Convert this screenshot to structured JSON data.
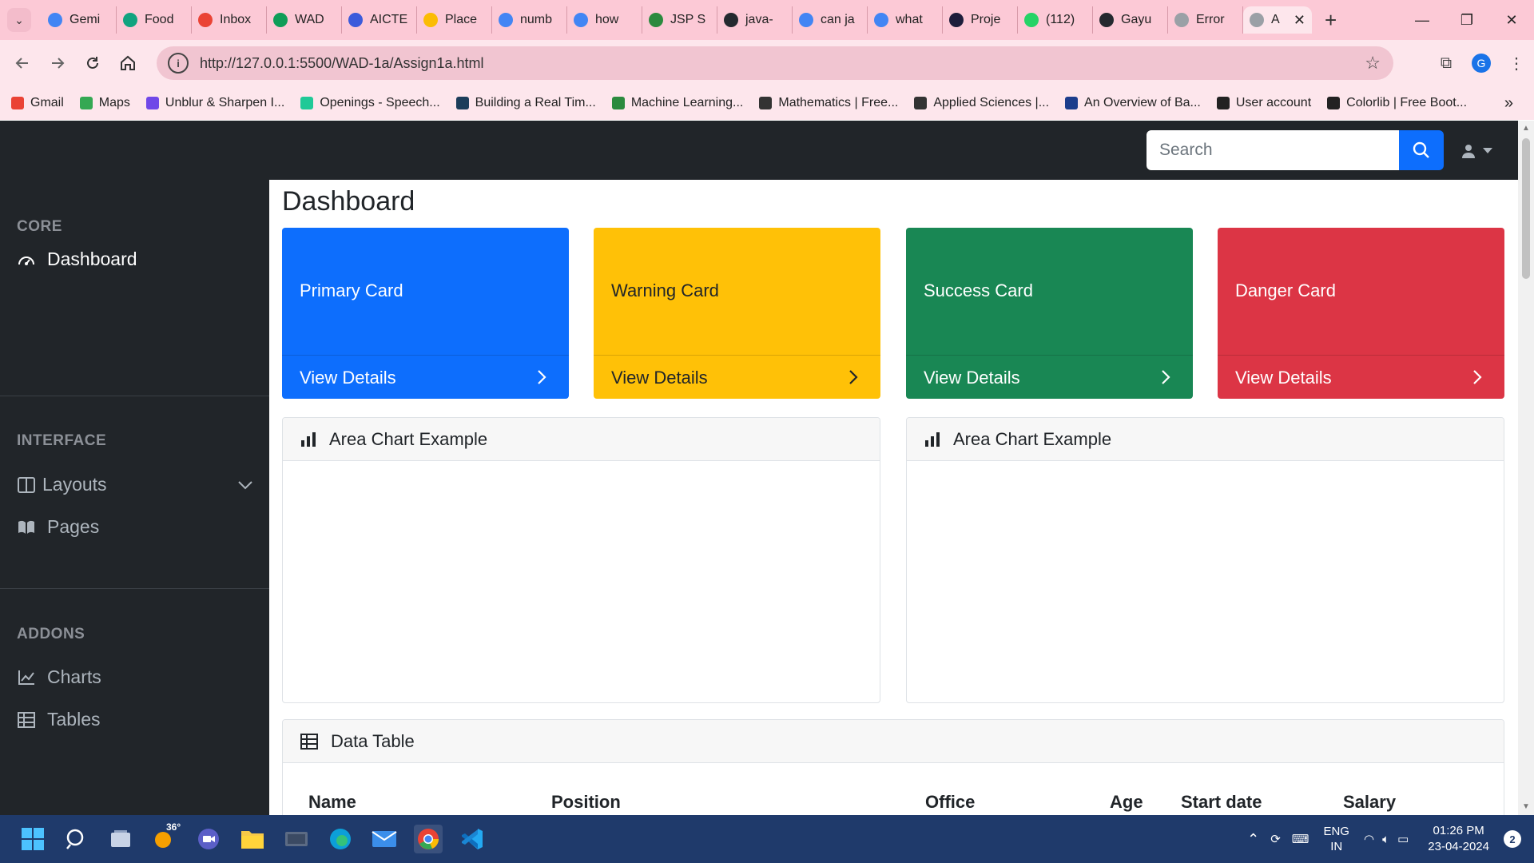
{
  "browser": {
    "tabs": [
      {
        "title": "Gemi",
        "icon": "gemini-icon",
        "color": "#4285f4"
      },
      {
        "title": "Food",
        "icon": "openai-icon",
        "color": "#10a37f"
      },
      {
        "title": "Inbox",
        "icon": "gmail-icon",
        "color": "#ea4335"
      },
      {
        "title": "WAD",
        "icon": "sheets-icon",
        "color": "#0f9d58"
      },
      {
        "title": "AICTE",
        "icon": "aicte-icon",
        "color": "#3b5bdb"
      },
      {
        "title": "Place",
        "icon": "drive-icon",
        "color": "#fbbc04"
      },
      {
        "title": "numb",
        "icon": "google-icon",
        "color": "#4285f4"
      },
      {
        "title": "how",
        "icon": "google-icon",
        "color": "#4285f4"
      },
      {
        "title": "JSP S",
        "icon": "jsp-icon",
        "color": "#2b8a3e"
      },
      {
        "title": "java-",
        "icon": "github-icon",
        "color": "#24292f"
      },
      {
        "title": "can ja",
        "icon": "google-icon",
        "color": "#4285f4"
      },
      {
        "title": "what",
        "icon": "google-icon",
        "color": "#4285f4"
      },
      {
        "title": "Proje",
        "icon": "tumblr-icon",
        "color": "#1d1d3b"
      },
      {
        "title": "(112)",
        "icon": "whatsapp-icon",
        "color": "#25d366"
      },
      {
        "title": "Gayu",
        "icon": "github-icon",
        "color": "#24292f"
      },
      {
        "title": "Error",
        "icon": "globe-icon",
        "color": "#9aa0a6"
      }
    ],
    "active_tab": {
      "title": "A",
      "icon": "globe-icon"
    },
    "url": "http://127.0.0.1:5500/WAD-1a/Assign1a.html",
    "profile_initial": "G",
    "bookmarks": [
      {
        "label": "Gmail",
        "color": "#ea4335",
        "icon": "gmail-icon"
      },
      {
        "label": "Maps",
        "color": "#34a853",
        "icon": "maps-icon"
      },
      {
        "label": "Unblur & Sharpen I...",
        "color": "#7048e8",
        "icon": "unblur-icon"
      },
      {
        "label": "Openings - Speech...",
        "color": "#20c997",
        "icon": "cloud-icon"
      },
      {
        "label": "Building a Real Tim...",
        "color": "#1c3d5a",
        "icon": "sds-icon"
      },
      {
        "label": "Machine Learning...",
        "color": "#2b8a3e",
        "icon": "check-icon"
      },
      {
        "label": "Mathematics | Free...",
        "color": "#333333",
        "icon": "lock-icon"
      },
      {
        "label": "Applied Sciences |...",
        "color": "#333333",
        "icon": "lock-icon"
      },
      {
        "label": "An Overview of Ba...",
        "color": "#1c3d8c",
        "icon": "ieee-icon"
      },
      {
        "label": "User account",
        "color": "#222222",
        "icon": "globe-icon"
      },
      {
        "label": "Colorlib | Free Boot...",
        "color": "#222222",
        "icon": "globe-icon"
      }
    ]
  },
  "topnav": {
    "search_placeholder": "Search"
  },
  "sidebar": {
    "sections": [
      {
        "heading": "CORE"
      },
      {
        "heading": "INTERFACE"
      },
      {
        "heading": "ADDONS"
      }
    ],
    "items": [
      {
        "label": "Dashboard",
        "icon": "dashboard-icon"
      },
      {
        "label": "Layouts",
        "icon": "columns-icon"
      },
      {
        "label": "Pages",
        "icon": "book-icon"
      },
      {
        "label": "Charts",
        "icon": "chart-line-icon"
      },
      {
        "label": "Tables",
        "icon": "table-icon"
      }
    ]
  },
  "main": {
    "title": "Dashboard",
    "cards": [
      {
        "title": "Primary Card",
        "link": "View Details",
        "color": "#0d6efd"
      },
      {
        "title": "Warning Card",
        "link": "View Details",
        "color": "#ffc107"
      },
      {
        "title": "Success Card",
        "link": "View Details",
        "color": "#198754"
      },
      {
        "title": "Danger Card",
        "link": "View Details",
        "color": "#dc3545"
      }
    ],
    "chart_panels": [
      {
        "title": "Area Chart Example"
      },
      {
        "title": "Area Chart Example"
      }
    ],
    "table": {
      "title": "Data Table",
      "columns": [
        "Name",
        "Position",
        "Office",
        "Age",
        "Start date",
        "Salary"
      ]
    }
  },
  "taskbar": {
    "weather_temp": "36°",
    "language": "ENG",
    "region": "IN",
    "time": "01:26 PM",
    "date": "23-04-2024",
    "notification_count": "2"
  }
}
